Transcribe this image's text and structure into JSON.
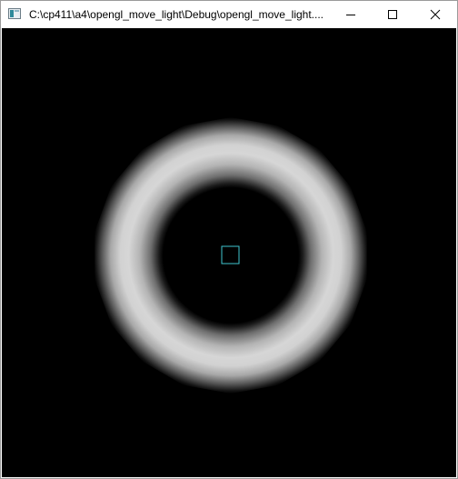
{
  "window": {
    "title": "C:\\cp411\\a4\\opengl_move_light\\Debug\\opengl_move_light....",
    "icon": "application-icon",
    "controls": {
      "minimize": "minimize-icon",
      "maximize": "maximize-icon",
      "close": "close-icon"
    }
  },
  "scene": {
    "background_color": "#000000",
    "torus_color_bright": "#d6d6d6",
    "torus_color_dark": "#0a0a0a",
    "light_marker_color": "#3fc6d0"
  }
}
